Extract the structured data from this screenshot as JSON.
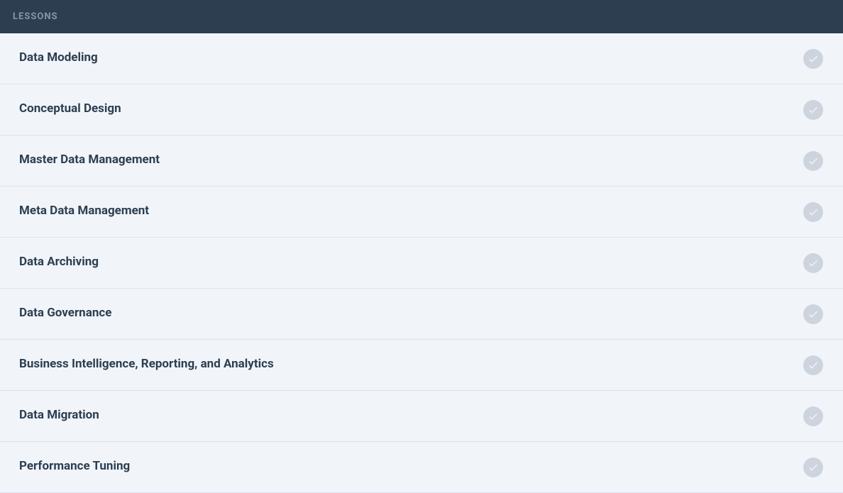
{
  "header": {
    "title": "LESSONS"
  },
  "lessons": [
    {
      "title": "Data Modeling"
    },
    {
      "title": "Conceptual Design"
    },
    {
      "title": "Master Data Management"
    },
    {
      "title": "Meta Data Management"
    },
    {
      "title": "Data Archiving"
    },
    {
      "title": "Data Governance"
    },
    {
      "title": "Business Intelligence, Reporting, and Analytics"
    },
    {
      "title": "Data Migration"
    },
    {
      "title": "Performance Tuning"
    }
  ]
}
